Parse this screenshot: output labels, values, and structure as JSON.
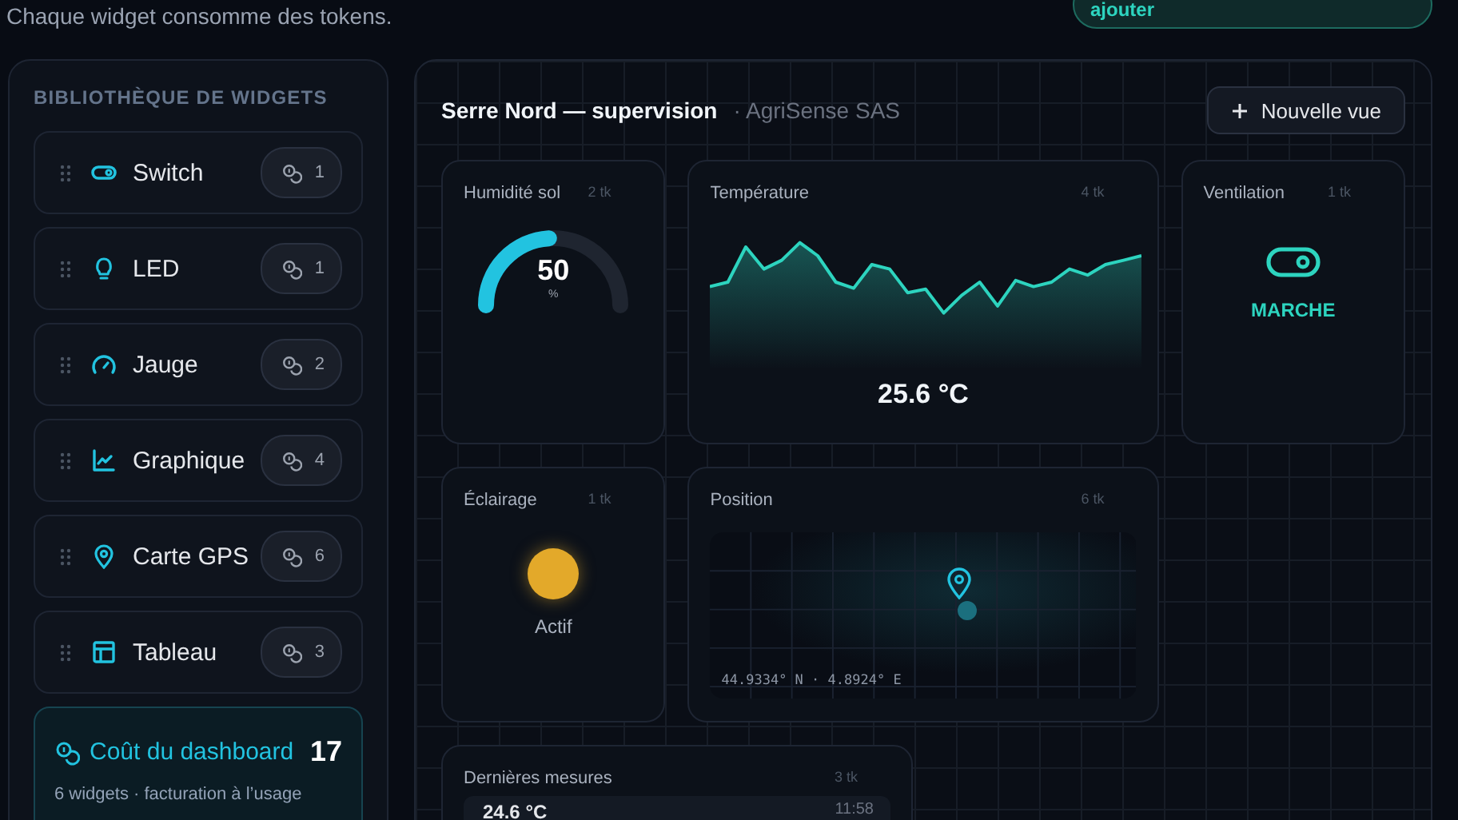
{
  "header": {
    "subtitle": "Chaque widget consomme des tokens.",
    "action": "ajouter"
  },
  "library": {
    "title": "BIBLIOTHÈQUE DE WIDGETS",
    "items": [
      {
        "kind": "switch",
        "label": "Switch",
        "tokens": "1"
      },
      {
        "kind": "led",
        "label": "LED",
        "tokens": "1"
      },
      {
        "kind": "gauge",
        "label": "Jauge",
        "tokens": "2"
      },
      {
        "kind": "chart",
        "label": "Graphique",
        "tokens": "4"
      },
      {
        "kind": "map",
        "label": "Carte GPS",
        "tokens": "6"
      },
      {
        "kind": "table",
        "label": "Tableau",
        "tokens": "3"
      }
    ]
  },
  "cost": {
    "title": "Coût du dashboard",
    "total": "17",
    "note": "6 widgets · facturation à l’usage"
  },
  "dashboard": {
    "title": "Serre Nord — supervision",
    "org": "· AgriSense SAS",
    "button": "Nouvelle vue",
    "widgets": [
      {
        "kind": "gauge",
        "title": "Humidité sol",
        "tokens": "2 tk",
        "value": "50",
        "unit": "%"
      },
      {
        "kind": "chart",
        "title": "Température",
        "tokens": "4 tk",
        "value": "25.6 °C"
      },
      {
        "kind": "switch",
        "title": "Ventilation",
        "tokens": "1 tk",
        "on": true,
        "state": "MARCHE"
      },
      {
        "kind": "led",
        "title": "Éclairage",
        "tokens": "1 tk",
        "on": true,
        "state": "Actif"
      },
      {
        "kind": "map",
        "title": "Position",
        "tokens": "6 tk",
        "coords": "44.9334° N · 4.8924° E"
      },
      {
        "kind": "table",
        "title": "Dernières mesures",
        "tokens": "3 tk",
        "rows": [
          {
            "value": "24.6 °C",
            "time": "11:58"
          }
        ]
      }
    ]
  }
}
